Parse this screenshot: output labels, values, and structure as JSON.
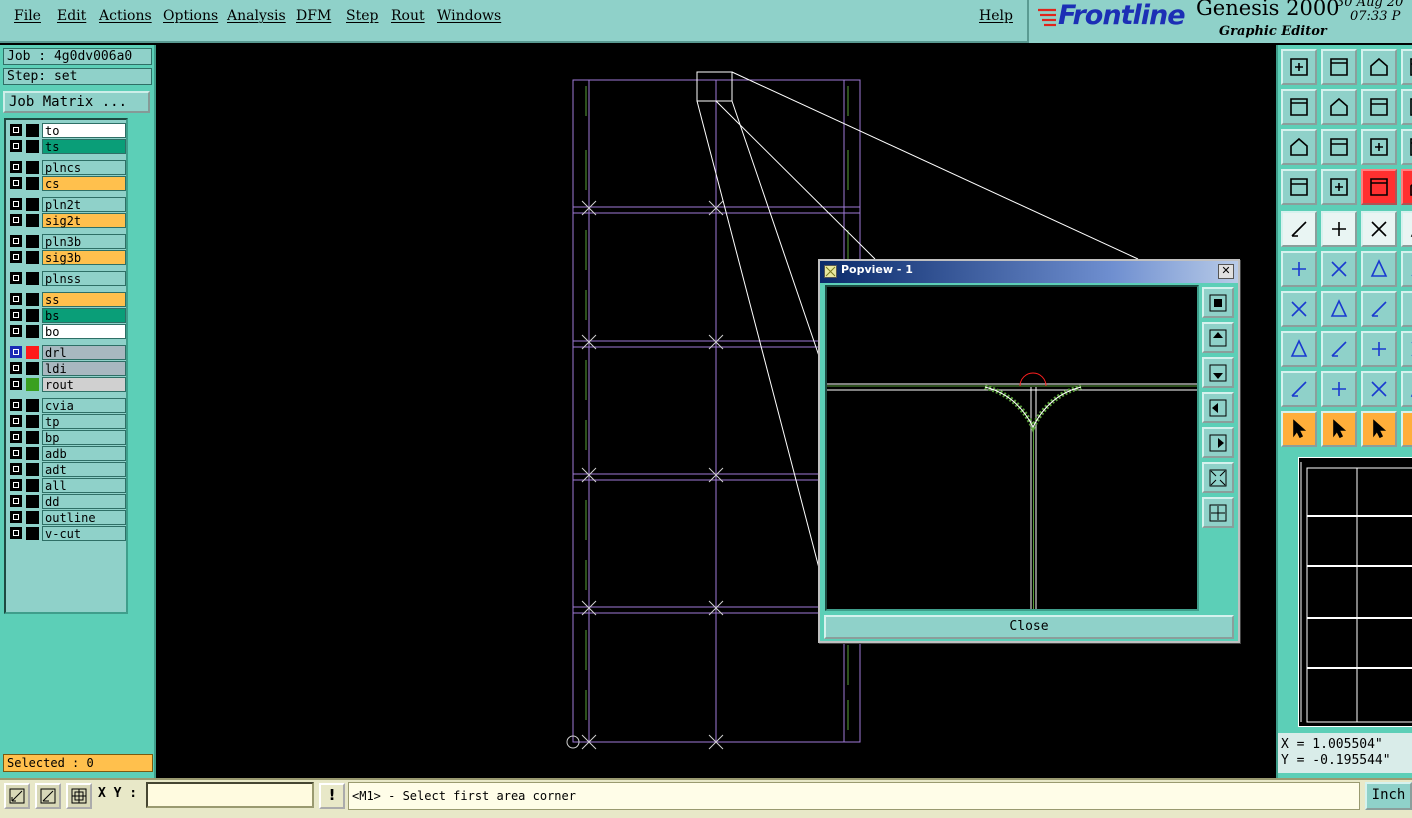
{
  "menu": {
    "items": [
      "File",
      "Edit",
      "Actions",
      "Options",
      "Analysis",
      "DFM",
      "Step",
      "Rout",
      "Windows"
    ],
    "help": "Help"
  },
  "brand": {
    "logo": "Frontline",
    "product": "Genesis 2000",
    "subtitle": "Graphic Editor",
    "date": "30 Aug 20",
    "time": "07:33 P"
  },
  "job": {
    "job_line": "Job : 4g0dv006a0",
    "step_line": "Step: set",
    "matrix_button": "Job Matrix ..."
  },
  "layers": [
    {
      "name": "to",
      "color": "#ffffff"
    },
    {
      "name": "ts",
      "color": "#0a9e78"
    },
    {
      "name": "plncs",
      "color": "#8fd1c9"
    },
    {
      "name": "cs",
      "color": "#ffc04d"
    },
    {
      "name": "pln2t",
      "color": "#8fd1c9"
    },
    {
      "name": "sig2t",
      "color": "#ffc04d"
    },
    {
      "name": "pln3b",
      "color": "#8fd1c9"
    },
    {
      "name": "sig3b",
      "color": "#ffc04d"
    },
    {
      "name": "plnss",
      "color": "#8fd1c9"
    },
    {
      "name": "ss",
      "color": "#ffc04d"
    },
    {
      "name": "bs",
      "color": "#0a9e78"
    },
    {
      "name": "bo",
      "color": "#ffffff"
    },
    {
      "name": "drl",
      "color": "#a8b8c0"
    },
    {
      "name": "ldi",
      "color": "#a8b8c0"
    },
    {
      "name": "rout",
      "color": "#d0d0d0"
    },
    {
      "name": "cvia",
      "color": "#8fd1c9"
    },
    {
      "name": "tp",
      "color": "#8fd1c9"
    },
    {
      "name": "bp",
      "color": "#8fd1c9"
    },
    {
      "name": "adb",
      "color": "#8fd1c9"
    },
    {
      "name": "adt",
      "color": "#8fd1c9"
    },
    {
      "name": "all",
      "color": "#8fd1c9"
    },
    {
      "name": "dd",
      "color": "#8fd1c9"
    },
    {
      "name": "outline",
      "color": "#8fd1c9"
    },
    {
      "name": "v-cut",
      "color": "#8fd1c9"
    }
  ],
  "selected_text": "Selected : 0",
  "popview": {
    "title": "Popview - 1",
    "close_label": "Close"
  },
  "coords": {
    "x": "X = 1.005504\"",
    "y": "Y = -0.195544\""
  },
  "bottom": {
    "xy_label": "X Y :",
    "xy_value": "",
    "warn": "!",
    "status": "<M1> - Select first area corner",
    "units": "Inch"
  }
}
